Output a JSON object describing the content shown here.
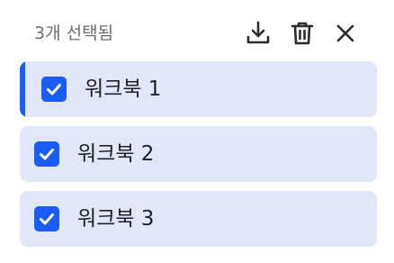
{
  "header": {
    "selection_count": "3개 선택됨",
    "icons": [
      "download-icon",
      "delete-icon",
      "close-icon"
    ]
  },
  "colors": {
    "accent": "#1a5cf5",
    "item_background": "#e2e7f8",
    "icon": "#2a2c30"
  },
  "items": [
    {
      "label": "워크북 1",
      "checked": true,
      "active": true
    },
    {
      "label": "워크북 2",
      "checked": true,
      "active": false
    },
    {
      "label": "워크북 3",
      "checked": true,
      "active": false
    }
  ]
}
